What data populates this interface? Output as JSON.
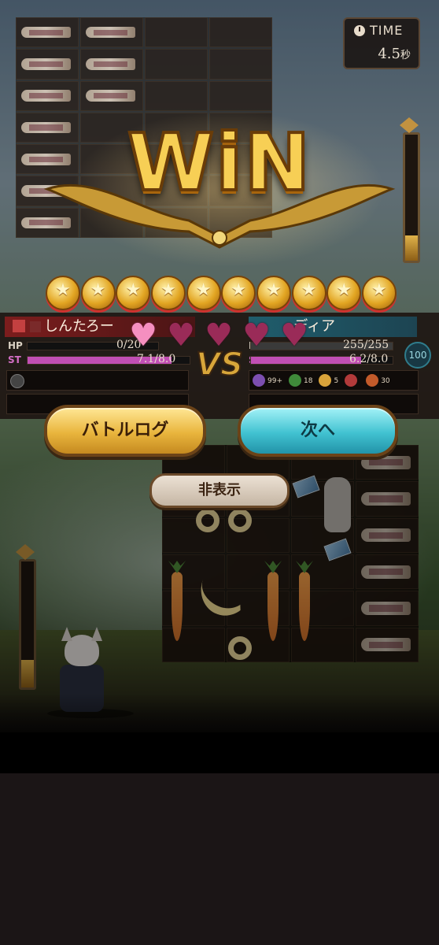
{
  "timer": {
    "label": "TIME",
    "value": "4.5",
    "unit": "秒",
    "icon": "clock-icon"
  },
  "result": {
    "title": "WiN"
  },
  "stars": {
    "count": 10,
    "icon": "star-medal-icon"
  },
  "player": {
    "name": "しんたろー",
    "hp_label": "HP",
    "hp_value": "0/20",
    "hp_fraction": 0,
    "st_label": "ST",
    "st_value": "7.1/8.0",
    "st_fraction": 0.8875
  },
  "opponent": {
    "name": "ディア",
    "hp_label": "HP",
    "hp_value": "255/255",
    "hp_fraction": 1,
    "st_label": "ST",
    "st_value": "6.2/8.0",
    "st_fraction": 0.775,
    "shield_value": "100",
    "effects": [
      {
        "color": "#7c4fb0",
        "num": "99+"
      },
      {
        "color": "#3f8a3a",
        "num": "18"
      },
      {
        "color": "#d9a33a",
        "num": "5"
      },
      {
        "color": "#b23a3a",
        "num": ""
      },
      {
        "color": "#c25a2a",
        "num": "30"
      }
    ]
  },
  "vs_label": "VS",
  "hearts": {
    "filled": 1,
    "total": 5
  },
  "buttons": {
    "battle_log": "バトルログ",
    "next": "次へ",
    "hide": "非表示"
  },
  "colors": {
    "gold": "#f7cf55",
    "hp_bar": "#d8d0c2",
    "st_bar": "#c14fb4",
    "opponent_hp_bar": "#3a3a3a"
  }
}
